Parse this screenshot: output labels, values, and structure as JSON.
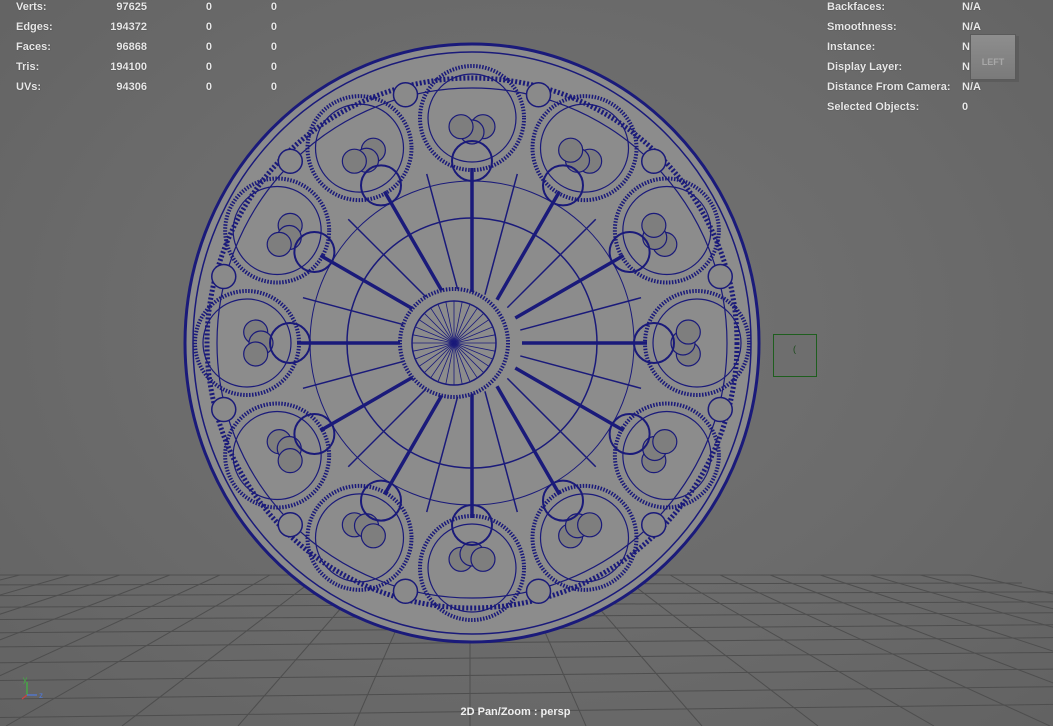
{
  "hud_left": [
    {
      "label": "Verts:",
      "a": "97625",
      "b": "0",
      "c": "0"
    },
    {
      "label": "Edges:",
      "a": "194372",
      "b": "0",
      "c": "0"
    },
    {
      "label": "Faces:",
      "a": "96868",
      "b": "0",
      "c": "0"
    },
    {
      "label": "Tris:",
      "a": "194100",
      "b": "0",
      "c": "0"
    },
    {
      "label": "UVs:",
      "a": "94306",
      "b": "0",
      "c": "0"
    }
  ],
  "hud_right": [
    {
      "label": "Backfaces:",
      "value": "N/A"
    },
    {
      "label": "Smoothness:",
      "value": "N/A"
    },
    {
      "label": "Instance:",
      "value": "N/A"
    },
    {
      "label": "Display Layer:",
      "value": "N/A"
    },
    {
      "label": "Distance From Camera:",
      "value": "N/A"
    },
    {
      "label": "Selected Objects:",
      "value": "0"
    }
  ],
  "viewcube": {
    "face_label": "LEFT"
  },
  "footer": {
    "pan_zoom_label": "2D Pan/Zoom : persp"
  },
  "axis": {
    "y": "y",
    "z": "z"
  },
  "selection_marker": {
    "glyph": "("
  },
  "colors": {
    "wireframe": "#1a1a7a",
    "surface": "#8c8c8c",
    "grid": "#4e4e4e",
    "axis_y": "#3fb83f",
    "axis_x": "#d04040",
    "axis_z": "#4f7ae0"
  }
}
